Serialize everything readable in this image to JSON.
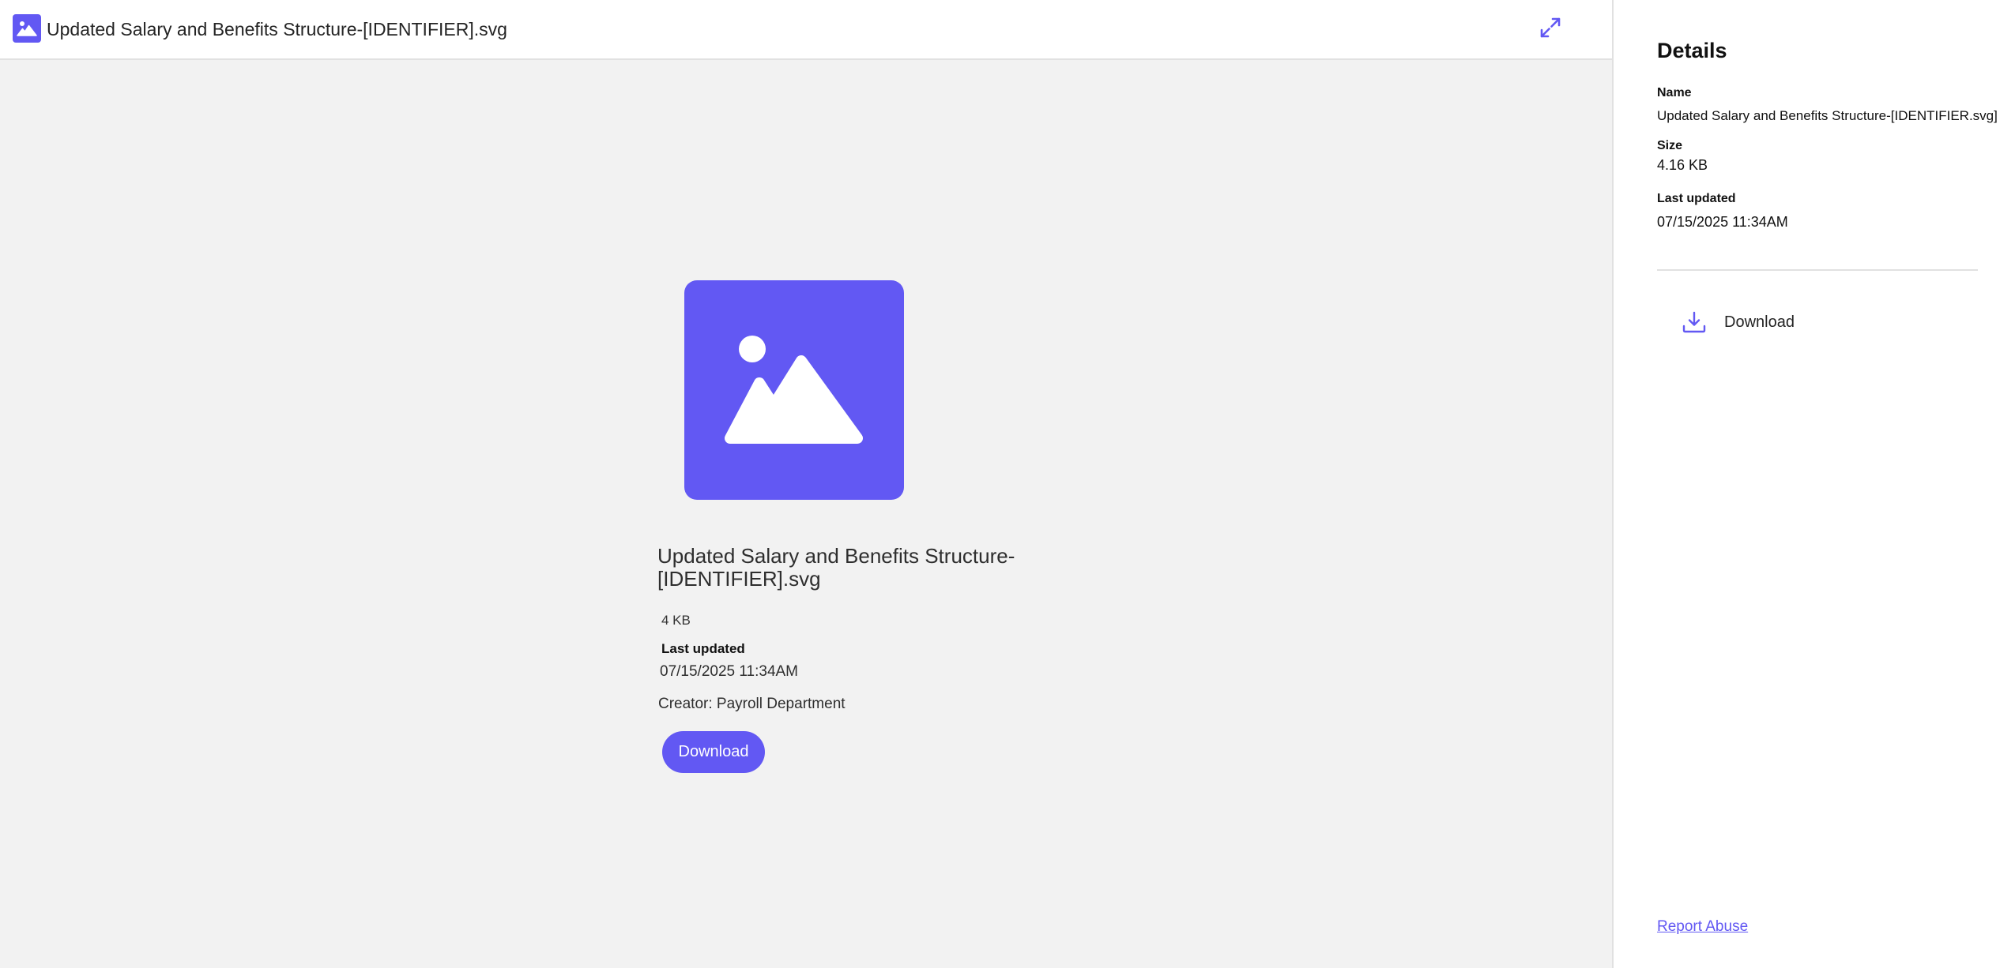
{
  "header": {
    "file_icon": "image-icon",
    "file_title": "Updated Salary and Benefits Structure-[IDENTIFIER].svg",
    "expand_icon": "expand-icon"
  },
  "preview": {
    "image_icon": "image-placeholder-icon",
    "name": "Updated Salary and Benefits Structure-[IDENTIFIER].svg",
    "size": "4 KB",
    "last_updated_label": "Last updated",
    "last_updated_value": "07/15/2025 11:34AM",
    "creator": "Creator: Payroll Department",
    "download_label": "Download"
  },
  "details": {
    "title": "Details",
    "name_label": "Name",
    "name_value": "Updated Salary and Benefits Structure-[IDENTIFIER.svg]",
    "size_label": "Size",
    "size_value": "4.16 KB",
    "last_updated_label": "Last updated",
    "last_updated_value": "07/15/2025 11:34AM",
    "download_label": "Download",
    "download_icon": "download-icon",
    "report_abuse": "Report Abuse"
  },
  "colors": {
    "accent": "#6258f3",
    "background": "#f2f2f2",
    "panel": "#ffffff"
  }
}
